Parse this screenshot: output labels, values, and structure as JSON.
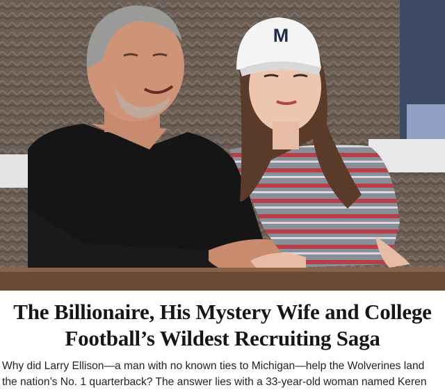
{
  "photo": {
    "alt_subjects": [
      "man-in-black-sweater",
      "woman-in-michigan-cap"
    ],
    "cap_letter": "M",
    "colors": {
      "wicker": "#6b5e54",
      "sweater": "#151515",
      "cap": "#f4f4f4",
      "cap_logo": "#1f2a50",
      "stripe_red": "#b5404a",
      "stripe_gray": "#8a8e96",
      "ledge": "#6b4a35"
    }
  },
  "article": {
    "headline_line1": "The Billionaire, His Mystery Wife and College",
    "headline_line2": "Football’s Wildest Recruiting Saga",
    "dek_line1": "Why did Larry Ellison—a man with no known ties to Michigan—help the Wolverines land",
    "dek_line2": "the nation’s No. 1 quarterback? The answer lies with a 33-year-old woman named Keren"
  }
}
